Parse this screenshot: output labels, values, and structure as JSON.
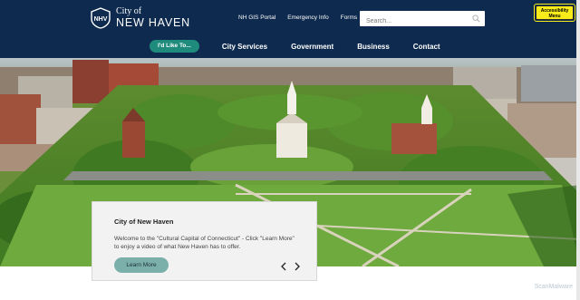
{
  "header": {
    "logo_city": "City of",
    "logo_name": "NEW HAVEN",
    "logo_badge": "NHV",
    "util_links": [
      "NH GIS Portal",
      "Emergency Info",
      "Forms"
    ],
    "search_placeholder": "Search...",
    "accessibility_label": "Accessibility Menu",
    "colors": {
      "background": "#0e2a4e",
      "accent": "#1e8b7c",
      "accessibility": "#f7ec1a"
    }
  },
  "nav": {
    "pill": "I'd Like To...",
    "items": [
      "City Services",
      "Government",
      "Business",
      "Contact"
    ]
  },
  "hero_card": {
    "title": "City of New Haven",
    "description": "Welcome to the \"Cultural Capital of Connecticut\" - Click \"Learn More\" to enjoy a video of what New Haven has to offer.",
    "button": "Learn More",
    "prev_icon": "chevron-left-icon",
    "next_icon": "chevron-right-icon"
  },
  "watermark": "ScanMalware"
}
